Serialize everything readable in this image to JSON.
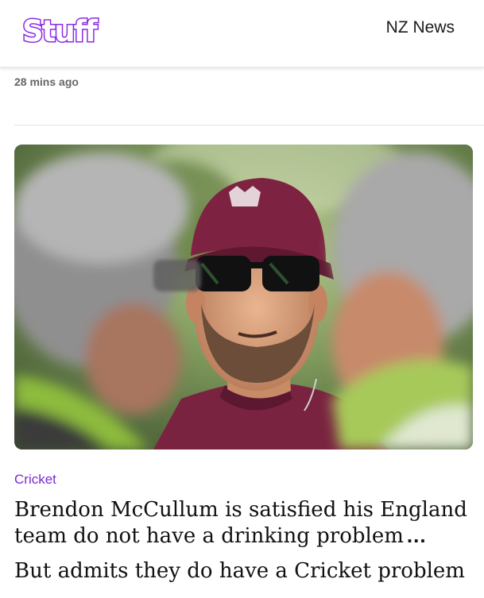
{
  "header": {
    "logo_text": "Stuff",
    "section_label": "NZ News"
  },
  "article": {
    "timestamp": "28 mins ago",
    "image_alt": "Brendon McCullum wearing an England cap and sunglasses",
    "category": "Cricket",
    "headline": "Brendon McCullum is satisfied his England team do not have a drinking problem",
    "ellipsis": "...",
    "subheadline": "But admits they do have a Cricket problem"
  },
  "colors": {
    "brand_purple": "#8a2be2",
    "category_purple": "#7b2bd1",
    "text": "#111111",
    "muted": "#666666"
  }
}
